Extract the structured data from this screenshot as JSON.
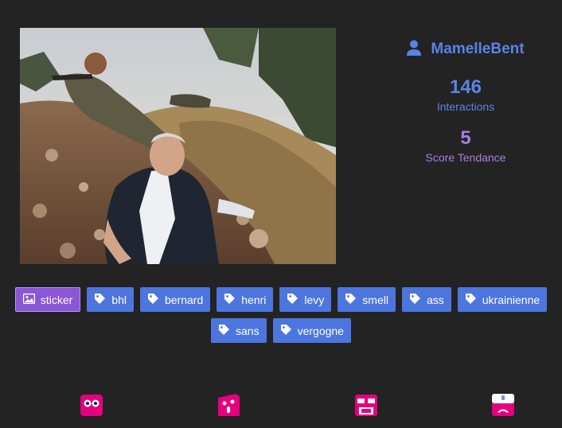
{
  "photo": {
    "alt_icon": "photo-image"
  },
  "profile": {
    "icon": "user-icon",
    "username": "MamelleBent",
    "interactions_value": "146",
    "interactions_label": "Interactions",
    "trend_value": "5",
    "trend_label": "Score Tendance"
  },
  "tags": {
    "type_tag": {
      "icon": "image-icon",
      "label": "sticker"
    },
    "items": [
      {
        "icon": "tag-icon",
        "label": "bhl"
      },
      {
        "icon": "tag-icon",
        "label": "bernard"
      },
      {
        "icon": "tag-icon",
        "label": "henri"
      },
      {
        "icon": "tag-icon",
        "label": "levy"
      },
      {
        "icon": "tag-icon",
        "label": "smell"
      },
      {
        "icon": "tag-icon",
        "label": "ass"
      },
      {
        "icon": "tag-icon",
        "label": "ukrainienne"
      },
      {
        "icon": "tag-icon",
        "label": "sans"
      },
      {
        "icon": "tag-icon",
        "label": "vergogne"
      }
    ]
  },
  "bottom_icons": [
    "robot-eyes-icon",
    "robot-mouth-icon",
    "robot-face-icon",
    "robot-sad-icon"
  ],
  "colors": {
    "background": "#232323",
    "accent_blue": "#5b82e8",
    "accent_purple": "#a77de3",
    "bot_pink": "#e5007e"
  }
}
